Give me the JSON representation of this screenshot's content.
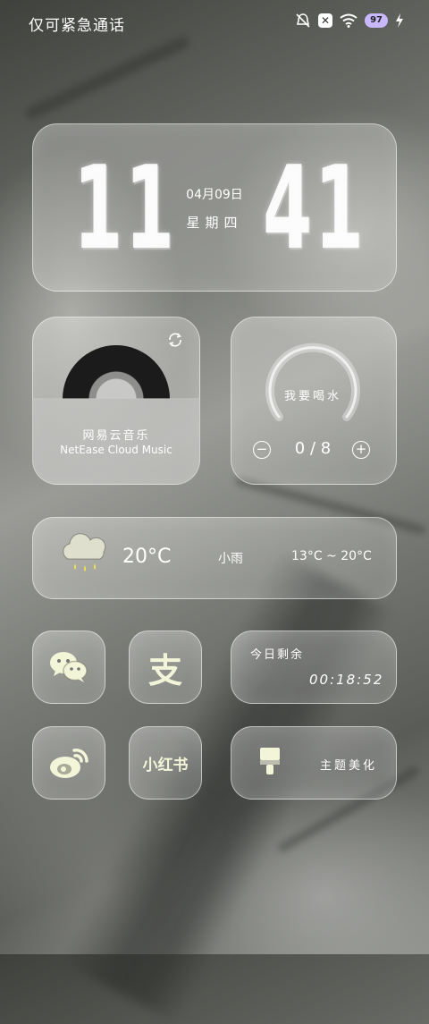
{
  "status_bar": {
    "carrier_text": "仅可紧急通话",
    "battery_level": "97",
    "icons": [
      "bell-muted-icon",
      "close-box-icon",
      "wifi-icon",
      "battery-icon",
      "charging-bolt-icon"
    ]
  },
  "clock_widget": {
    "hour": "11",
    "minute": "41",
    "date": "04月09日",
    "weekday": "星期四"
  },
  "music_widget": {
    "title": "网易云音乐",
    "subtitle": "NetEase Cloud Music",
    "icons": [
      "vinyl-record-icon",
      "sync-icon"
    ]
  },
  "water_widget": {
    "label": "我要喝水",
    "count": "0 / 8",
    "progress": 0,
    "minus_label": "−",
    "plus_label": "+"
  },
  "weather_widget": {
    "temperature": "20°C",
    "condition": "小雨",
    "range": "13°C ~ 20°C",
    "icon": "rain-cloud-icon"
  },
  "apps": {
    "wechat_icon": "wechat-icon",
    "alipay_glyph": "支",
    "weibo_icon": "weibo-icon",
    "xiaohongshu_text": "小红书",
    "theme_icon": "paint-brush-icon"
  },
  "countdown_widget": {
    "label": "今日剩余",
    "time": "00:18:52"
  },
  "theme_widget": {
    "label": "主题美化"
  },
  "colors": {
    "accent_yellow": "#f3f5d8",
    "battery_badge": "#c9b8ff"
  }
}
